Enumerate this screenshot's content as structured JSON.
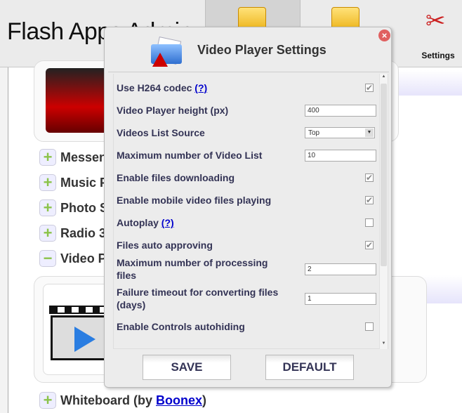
{
  "header": {
    "app_title": "Flash Apps Admin",
    "settings_label": "Settings"
  },
  "modules": [
    {
      "label": "Messenger",
      "state": "plus"
    },
    {
      "label": "Music Player",
      "state": "plus"
    },
    {
      "label": "Photo Shoot",
      "state": "plus"
    },
    {
      "label": "Radio 3",
      "state": "plus"
    },
    {
      "label": "Video Player",
      "state": "minus"
    }
  ],
  "whiteboard": {
    "prefix": "Whiteboard (by ",
    "link": "Boonex",
    "suffix": ")"
  },
  "dialog": {
    "title": "Video Player Settings",
    "help_link": "(?)",
    "rows": [
      {
        "label": "Use H264 codec",
        "help": true,
        "type": "checkbox",
        "checked": true
      },
      {
        "label": "Video Player height (px)",
        "type": "text",
        "value": "400"
      },
      {
        "label": "Videos List Source",
        "type": "select",
        "value": "Top"
      },
      {
        "label": "Maximum number of Video List",
        "type": "text",
        "value": "10"
      },
      {
        "label": "Enable files downloading",
        "type": "checkbox",
        "checked": true
      },
      {
        "label": "Enable mobile video files playing",
        "type": "checkbox",
        "checked": true
      },
      {
        "label": "Autoplay",
        "help": true,
        "type": "checkbox",
        "checked": false
      },
      {
        "label": "Files auto approving",
        "type": "checkbox",
        "checked": true
      },
      {
        "label": "Maximum number of processing files",
        "type": "text",
        "value": "2"
      },
      {
        "label": "Failure timeout for converting files (days)",
        "type": "text",
        "value": "1"
      },
      {
        "label": "Enable Controls autohiding",
        "type": "checkbox",
        "checked": false
      }
    ],
    "save_label": "SAVE",
    "default_label": "DEFAULT"
  }
}
